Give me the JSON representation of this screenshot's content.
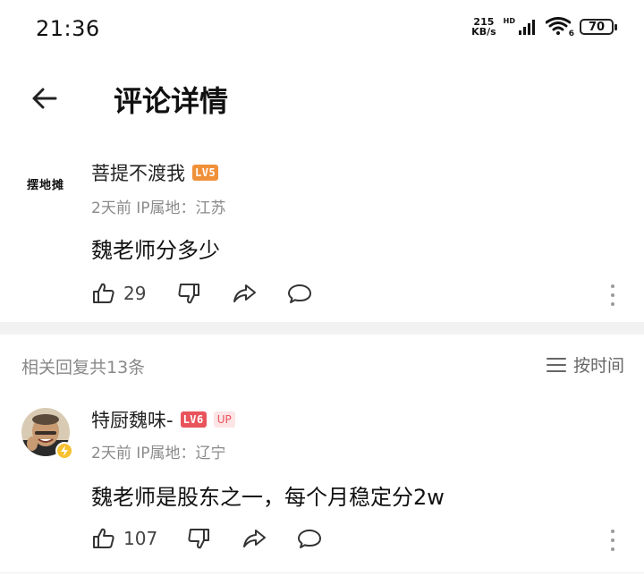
{
  "status_bar": {
    "time": "21:36",
    "net_speed_value": "215",
    "net_speed_unit": "KB/s",
    "signal_label": "HD",
    "wifi_badge": "6",
    "battery": "70"
  },
  "header": {
    "title": "评论详情"
  },
  "main_comment": {
    "avatar_text": "摆地摊",
    "username": "菩提不渡我",
    "level": "LV5",
    "meta": "2天前 IP属地：江苏",
    "text": "魏老师分多少",
    "like_count": "29"
  },
  "replies": {
    "count_label": "相关回复共13条",
    "sort_label": "按时间"
  },
  "reply": {
    "username": "特厨魏味-",
    "level": "LV6",
    "up_badge": "UP",
    "meta": "2天前 IP属地：辽宁",
    "text": "魏老师是股东之一，每个月稳定分2w",
    "like_count": "107"
  },
  "colors": {
    "lv5": "#f0913a",
    "lv6": "#e9545b",
    "verified": "#f6c02e"
  }
}
